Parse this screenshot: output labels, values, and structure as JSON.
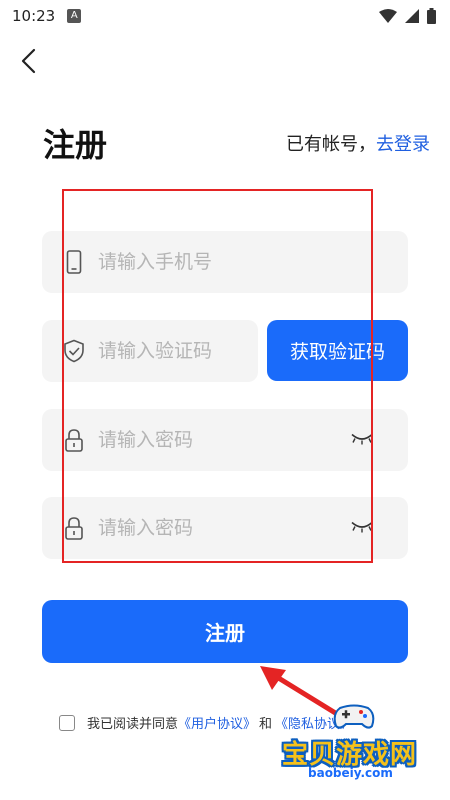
{
  "status_bar": {
    "time": "10:23",
    "notification_icon": "A"
  },
  "header": {
    "title": "注册",
    "have_account": "已有帐号，",
    "login_link": "去登录"
  },
  "form": {
    "phone_placeholder": "请输入手机号",
    "code_placeholder": "请输入验证码",
    "get_code_label": "获取验证码",
    "password_placeholder": "请输入密码",
    "confirm_password_placeholder": "请输入密码"
  },
  "register_label": "注册",
  "agreement": {
    "prefix": "我已阅读并同意",
    "user_agreement": "《用户协议》",
    "and": "和",
    "privacy": "《隐私协议》"
  },
  "watermark": {
    "text": "宝贝游戏网",
    "url": "baobeiy.com"
  },
  "colors": {
    "accent": "#1a6bfa",
    "link": "#1f5fe0",
    "highlight": "#e42424"
  }
}
